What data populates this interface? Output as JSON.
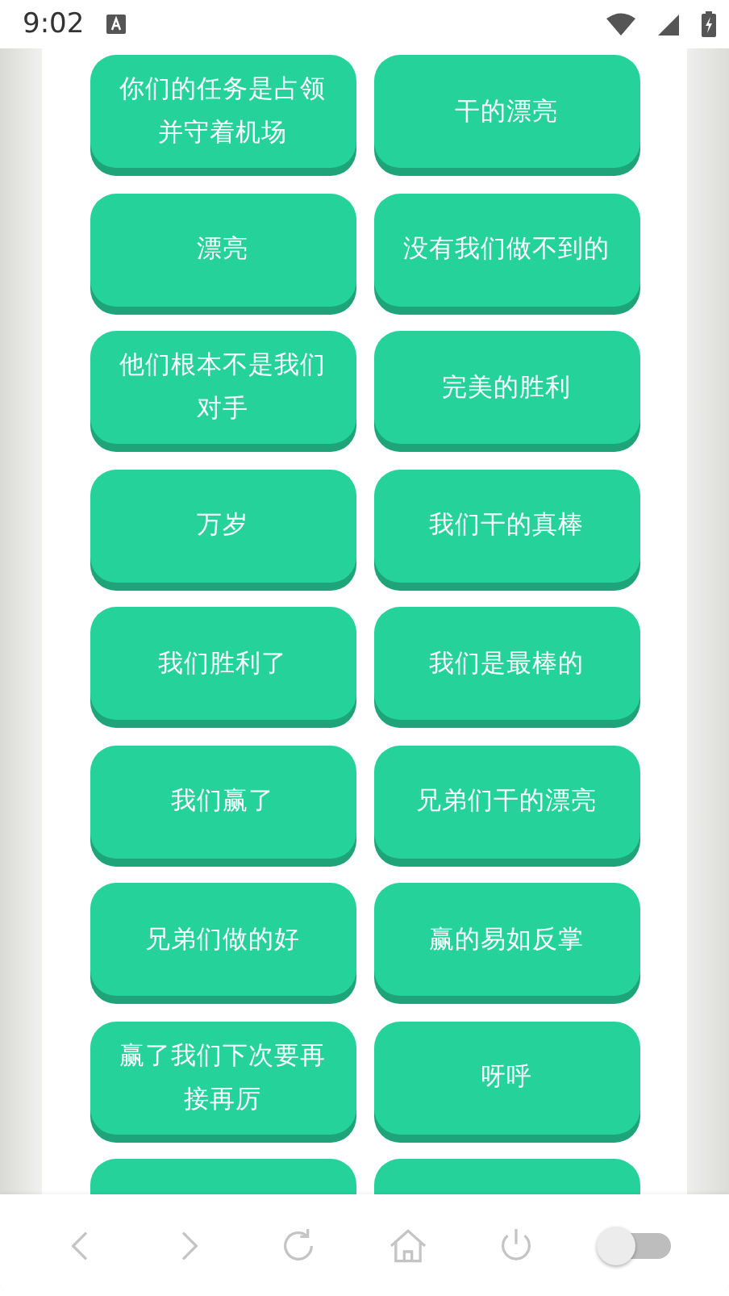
{
  "status_bar": {
    "time": "9:02"
  },
  "buttons": [
    {
      "label": "你们的任务是占领并守着机场"
    },
    {
      "label": "干的漂亮"
    },
    {
      "label": "漂亮"
    },
    {
      "label": "没有我们做不到的"
    },
    {
      "label": "他们根本不是我们对手"
    },
    {
      "label": "完美的胜利"
    },
    {
      "label": "万岁"
    },
    {
      "label": "我们干的真棒"
    },
    {
      "label": "我们胜利了"
    },
    {
      "label": "我们是最棒的"
    },
    {
      "label": "我们赢了"
    },
    {
      "label": "兄弟们干的漂亮"
    },
    {
      "label": "兄弟们做的好"
    },
    {
      "label": "赢的易如反掌"
    },
    {
      "label": "赢了我们下次要再接再厉"
    },
    {
      "label": "呀呼"
    }
  ],
  "partial_buttons": [
    {
      "kind": "button"
    },
    {
      "kind": "button"
    }
  ],
  "bottom_bar": {
    "toggle": {
      "on": false
    }
  }
}
